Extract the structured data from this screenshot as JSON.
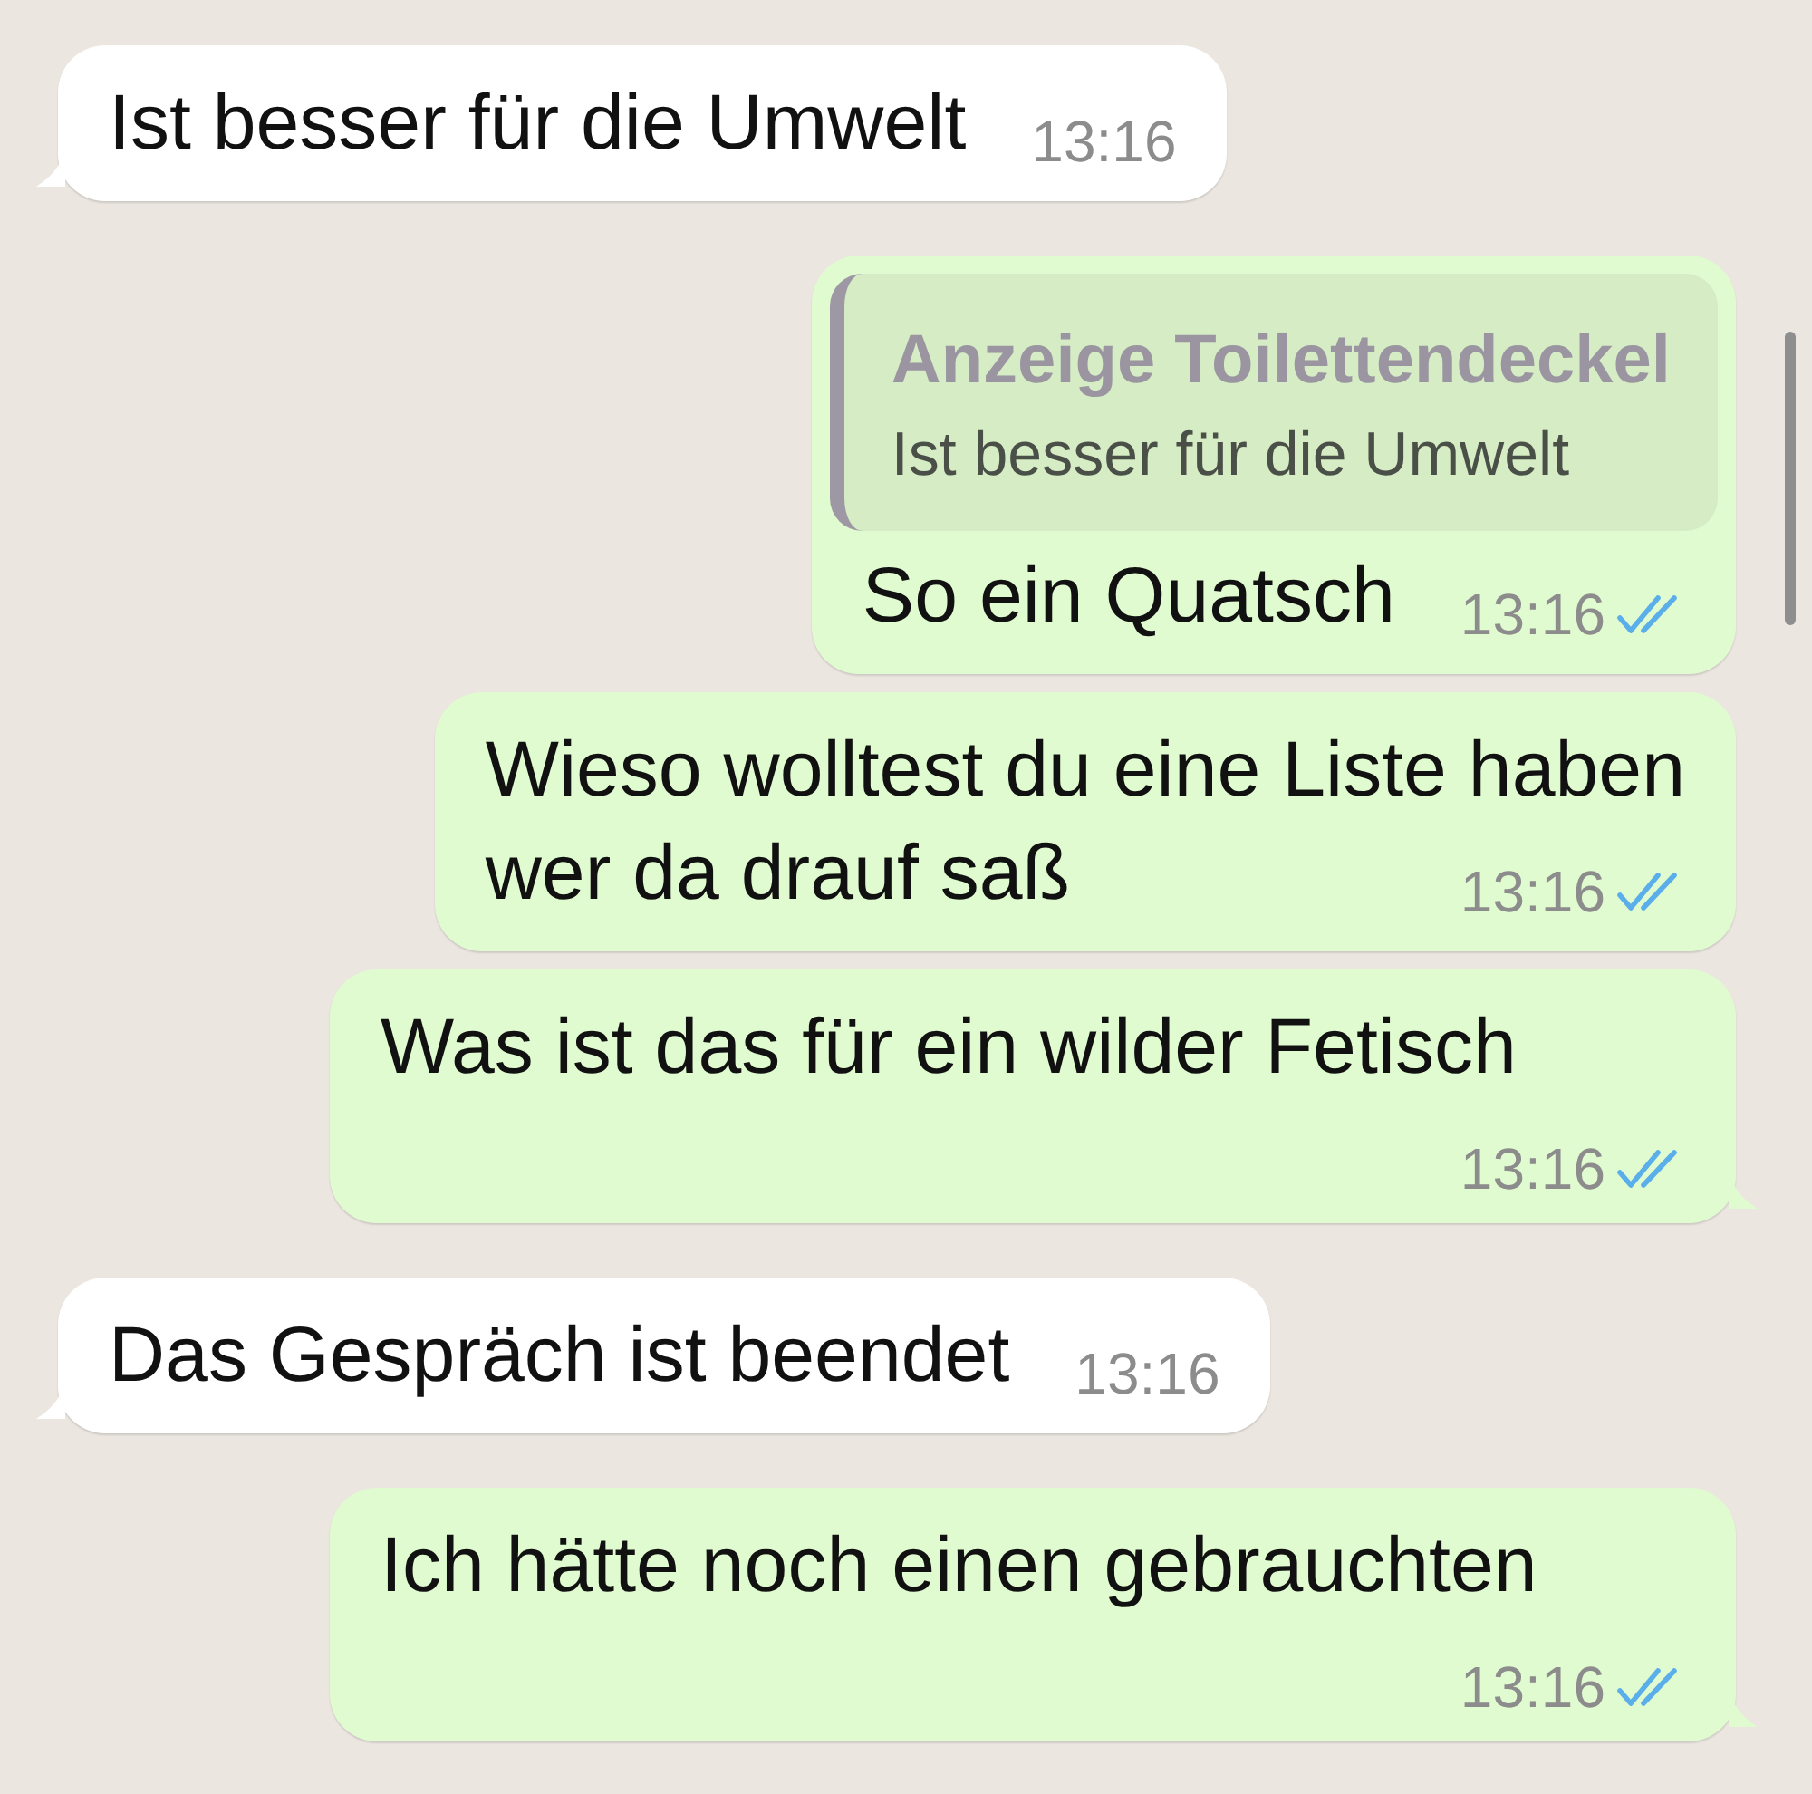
{
  "messages": [
    {
      "kind": "incoming",
      "lines": [
        "Ist besser für die Umwelt"
      ],
      "time": "13:16",
      "tail": true
    },
    {
      "kind": "outgoing",
      "quote": {
        "author": "Anzeige Toilettendeckel",
        "text": "Ist besser für die Umwelt"
      },
      "lines": [
        "So ein Quatsch"
      ],
      "time": "13:16",
      "read": true,
      "tail": false
    },
    {
      "kind": "outgoing",
      "lines": [
        "Wieso wolltest du eine Liste haben",
        "wer da drauf saß"
      ],
      "time": "13:16",
      "read": true,
      "tail": false
    },
    {
      "kind": "outgoing",
      "lines": [
        "Was ist das für ein wilder Fetisch"
      ],
      "time": "13:16",
      "read": true,
      "tail": true
    },
    {
      "kind": "incoming",
      "lines": [
        "Das Gespräch ist beendet"
      ],
      "time": "13:16",
      "tail": true
    },
    {
      "kind": "outgoing",
      "lines": [
        "Ich hätte noch einen gebrauchten"
      ],
      "time": "13:16",
      "read": true,
      "tail": true
    }
  ]
}
